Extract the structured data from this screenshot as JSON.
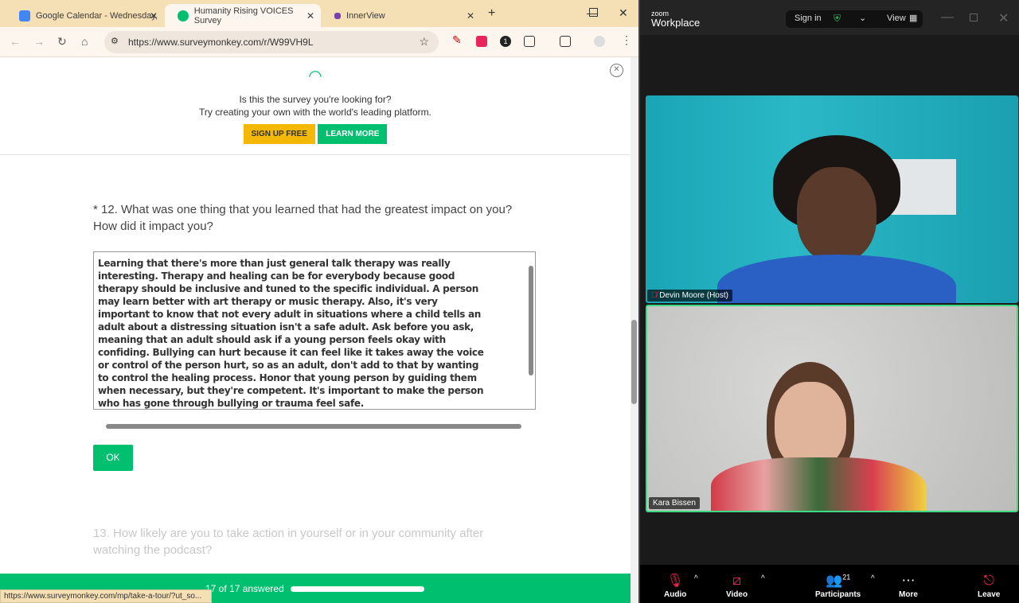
{
  "browser": {
    "tabs": [
      {
        "label": "Google Calendar - Wednesday,",
        "favicon": "calendar-icon"
      },
      {
        "label": "Humanity Rising VOICES Survey",
        "favicon": "surveymonkey-icon"
      },
      {
        "label": "InnerView",
        "favicon": "innerview-icon"
      }
    ],
    "url": "https://www.surveymonkey.com/r/W99VH9L",
    "ext_badge": "1",
    "status_url": "https://www.surveymonkey.com/mp/take-a-tour/?ut_so..."
  },
  "banner": {
    "line1": "Is this the survey you're looking for?",
    "line2": "Try creating your own with the world's leading platform.",
    "signup": "SIGN UP FREE",
    "learn": "LEARN MORE"
  },
  "question12": {
    "label": "* 12. What was one thing that you learned that had the greatest impact on you? How did it impact you?",
    "answer": "Learning that there's more than just general talk therapy was really interesting. Therapy and healing can be for everybody because good therapy should be inclusive and tuned to the specific individual. A person may learn better with art therapy or music therapy. Also, it's very important to know that not every adult in situations where a child tells an adult about a distressing situation isn't a safe adult. Ask before you ask, meaning that an adult should ask if a young person feels okay with confiding. Bullying can hurt because it can feel like it takes away the voice or control of the person hurt, so as an adult, don't add to that by wanting to control the healing process. Honor that young person by guiding them when necessary, but they're competent. It's important to make the person who has gone through bullying or trauma feel safe.",
    "ok": "OK"
  },
  "question13": {
    "label": "13. How likely are you to take action in yourself or in your community after watching the podcast?"
  },
  "progress": {
    "text": "17 of 17 answered",
    "fraction": 1.0
  },
  "zoom": {
    "brand_small": "zoom",
    "brand": "Workplace",
    "sign_in": "Sign in",
    "view": "View",
    "participants": [
      {
        "name": "Devin Moore (Host)",
        "muted": true
      },
      {
        "name": "Kara Bissen",
        "speaking": true
      }
    ],
    "controls": {
      "audio": "Audio",
      "video": "Video",
      "participants": "Participants",
      "participant_count": "21",
      "more": "More",
      "leave": "Leave"
    },
    "colors": {
      "active_speaker": "#3ddc84",
      "leave": "#e5254a"
    }
  },
  "colors": {
    "brand": "#00bf6f",
    "signup": "#f5b800"
  }
}
